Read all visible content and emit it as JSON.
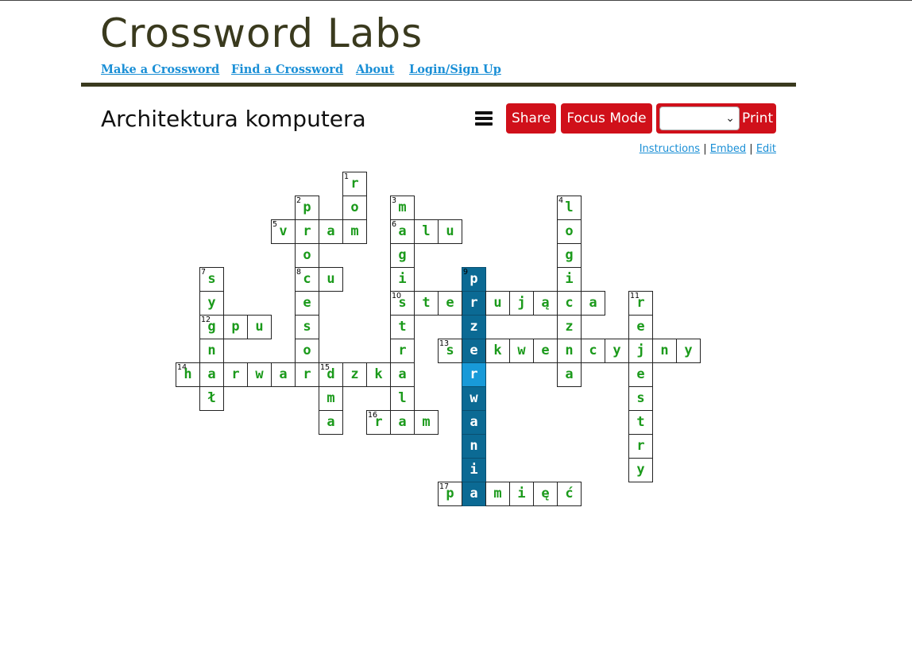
{
  "site": {
    "title": "Crossword Labs",
    "nav": [
      "Make a Crossword",
      "Find a Crossword",
      "About",
      "Login/Sign Up"
    ]
  },
  "puzzle": {
    "title": "Architektura komputera",
    "buttons": {
      "share": "Share",
      "focus": "Focus Mode",
      "print": "Print"
    },
    "print_select_value": "",
    "links": {
      "instructions": "Instructions",
      "embed": "Embed",
      "edit": "Edit"
    },
    "separator": "|"
  },
  "colors": {
    "accent_button": "#d0101a",
    "link": "#1a8fd6",
    "letter": "#1b9a1b",
    "highlight": "#0b6a94",
    "current_cell": "#189ad8"
  },
  "icons": {
    "menu": "hamburger-icon",
    "select": "chevron-down-icon"
  },
  "crossword": {
    "entries": [
      {
        "number": "1",
        "direction": "down",
        "row": 0,
        "col": 7,
        "answer": "ro"
      },
      {
        "number": "2",
        "direction": "down",
        "row": 1,
        "col": 5,
        "answer": "procesor"
      },
      {
        "number": "3",
        "direction": "down",
        "row": 1,
        "col": 9,
        "answer": "magistrala"
      },
      {
        "number": "4",
        "direction": "down",
        "row": 1,
        "col": 16,
        "answer": "logiczna"
      },
      {
        "number": "5",
        "direction": "across",
        "row": 2,
        "col": 4,
        "answer": "vram"
      },
      {
        "number": "6",
        "direction": "across",
        "row": 2,
        "col": 9,
        "answer": "alu"
      },
      {
        "number": "7",
        "direction": "down",
        "row": 4,
        "col": 1,
        "answer": "sygnał"
      },
      {
        "number": "8",
        "direction": "across",
        "row": 4,
        "col": 5,
        "answer": "cu"
      },
      {
        "number": "9",
        "direction": "down",
        "row": 4,
        "col": 12,
        "answer": "przerwania"
      },
      {
        "number": "10",
        "direction": "across",
        "row": 5,
        "col": 9,
        "answer": "sterująca"
      },
      {
        "number": "11",
        "direction": "down",
        "row": 5,
        "col": 19,
        "answer": "rejestry"
      },
      {
        "number": "12",
        "direction": "across",
        "row": 6,
        "col": 1,
        "answer": "gpu"
      },
      {
        "number": "13",
        "direction": "across",
        "row": 7,
        "col": 11,
        "answer": "sekwencyjny"
      },
      {
        "number": "14",
        "direction": "across",
        "row": 8,
        "col": 0,
        "answer": "harwardzka"
      },
      {
        "number": "15",
        "direction": "down",
        "row": 8,
        "col": 6,
        "answer": "dma"
      },
      {
        "number": "16",
        "direction": "across",
        "row": 10,
        "col": 8,
        "answer": "ram"
      },
      {
        "number": "17",
        "direction": "across",
        "row": 13,
        "col": 11,
        "answer": "pamięć"
      }
    ],
    "highlighted_entry": "9",
    "current_cell": {
      "row": 8,
      "col": 12
    }
  }
}
